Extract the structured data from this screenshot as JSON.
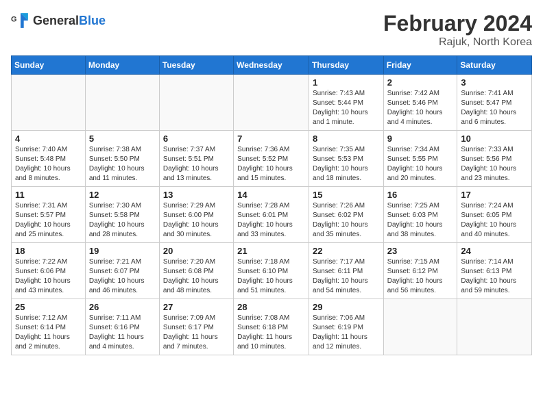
{
  "logo": {
    "general": "General",
    "blue": "Blue"
  },
  "header": {
    "month": "February 2024",
    "location": "Rajuk, North Korea"
  },
  "weekdays": [
    "Sunday",
    "Monday",
    "Tuesday",
    "Wednesday",
    "Thursday",
    "Friday",
    "Saturday"
  ],
  "weeks": [
    [
      {
        "day": "",
        "info": ""
      },
      {
        "day": "",
        "info": ""
      },
      {
        "day": "",
        "info": ""
      },
      {
        "day": "",
        "info": ""
      },
      {
        "day": "1",
        "info": "Sunrise: 7:43 AM\nSunset: 5:44 PM\nDaylight: 10 hours\nand 1 minute."
      },
      {
        "day": "2",
        "info": "Sunrise: 7:42 AM\nSunset: 5:46 PM\nDaylight: 10 hours\nand 4 minutes."
      },
      {
        "day": "3",
        "info": "Sunrise: 7:41 AM\nSunset: 5:47 PM\nDaylight: 10 hours\nand 6 minutes."
      }
    ],
    [
      {
        "day": "4",
        "info": "Sunrise: 7:40 AM\nSunset: 5:48 PM\nDaylight: 10 hours\nand 8 minutes."
      },
      {
        "day": "5",
        "info": "Sunrise: 7:38 AM\nSunset: 5:50 PM\nDaylight: 10 hours\nand 11 minutes."
      },
      {
        "day": "6",
        "info": "Sunrise: 7:37 AM\nSunset: 5:51 PM\nDaylight: 10 hours\nand 13 minutes."
      },
      {
        "day": "7",
        "info": "Sunrise: 7:36 AM\nSunset: 5:52 PM\nDaylight: 10 hours\nand 15 minutes."
      },
      {
        "day": "8",
        "info": "Sunrise: 7:35 AM\nSunset: 5:53 PM\nDaylight: 10 hours\nand 18 minutes."
      },
      {
        "day": "9",
        "info": "Sunrise: 7:34 AM\nSunset: 5:55 PM\nDaylight: 10 hours\nand 20 minutes."
      },
      {
        "day": "10",
        "info": "Sunrise: 7:33 AM\nSunset: 5:56 PM\nDaylight: 10 hours\nand 23 minutes."
      }
    ],
    [
      {
        "day": "11",
        "info": "Sunrise: 7:31 AM\nSunset: 5:57 PM\nDaylight: 10 hours\nand 25 minutes."
      },
      {
        "day": "12",
        "info": "Sunrise: 7:30 AM\nSunset: 5:58 PM\nDaylight: 10 hours\nand 28 minutes."
      },
      {
        "day": "13",
        "info": "Sunrise: 7:29 AM\nSunset: 6:00 PM\nDaylight: 10 hours\nand 30 minutes."
      },
      {
        "day": "14",
        "info": "Sunrise: 7:28 AM\nSunset: 6:01 PM\nDaylight: 10 hours\nand 33 minutes."
      },
      {
        "day": "15",
        "info": "Sunrise: 7:26 AM\nSunset: 6:02 PM\nDaylight: 10 hours\nand 35 minutes."
      },
      {
        "day": "16",
        "info": "Sunrise: 7:25 AM\nSunset: 6:03 PM\nDaylight: 10 hours\nand 38 minutes."
      },
      {
        "day": "17",
        "info": "Sunrise: 7:24 AM\nSunset: 6:05 PM\nDaylight: 10 hours\nand 40 minutes."
      }
    ],
    [
      {
        "day": "18",
        "info": "Sunrise: 7:22 AM\nSunset: 6:06 PM\nDaylight: 10 hours\nand 43 minutes."
      },
      {
        "day": "19",
        "info": "Sunrise: 7:21 AM\nSunset: 6:07 PM\nDaylight: 10 hours\nand 46 minutes."
      },
      {
        "day": "20",
        "info": "Sunrise: 7:20 AM\nSunset: 6:08 PM\nDaylight: 10 hours\nand 48 minutes."
      },
      {
        "day": "21",
        "info": "Sunrise: 7:18 AM\nSunset: 6:10 PM\nDaylight: 10 hours\nand 51 minutes."
      },
      {
        "day": "22",
        "info": "Sunrise: 7:17 AM\nSunset: 6:11 PM\nDaylight: 10 hours\nand 54 minutes."
      },
      {
        "day": "23",
        "info": "Sunrise: 7:15 AM\nSunset: 6:12 PM\nDaylight: 10 hours\nand 56 minutes."
      },
      {
        "day": "24",
        "info": "Sunrise: 7:14 AM\nSunset: 6:13 PM\nDaylight: 10 hours\nand 59 minutes."
      }
    ],
    [
      {
        "day": "25",
        "info": "Sunrise: 7:12 AM\nSunset: 6:14 PM\nDaylight: 11 hours\nand 2 minutes."
      },
      {
        "day": "26",
        "info": "Sunrise: 7:11 AM\nSunset: 6:16 PM\nDaylight: 11 hours\nand 4 minutes."
      },
      {
        "day": "27",
        "info": "Sunrise: 7:09 AM\nSunset: 6:17 PM\nDaylight: 11 hours\nand 7 minutes."
      },
      {
        "day": "28",
        "info": "Sunrise: 7:08 AM\nSunset: 6:18 PM\nDaylight: 11 hours\nand 10 minutes."
      },
      {
        "day": "29",
        "info": "Sunrise: 7:06 AM\nSunset: 6:19 PM\nDaylight: 11 hours\nand 12 minutes."
      },
      {
        "day": "",
        "info": ""
      },
      {
        "day": "",
        "info": ""
      }
    ]
  ]
}
